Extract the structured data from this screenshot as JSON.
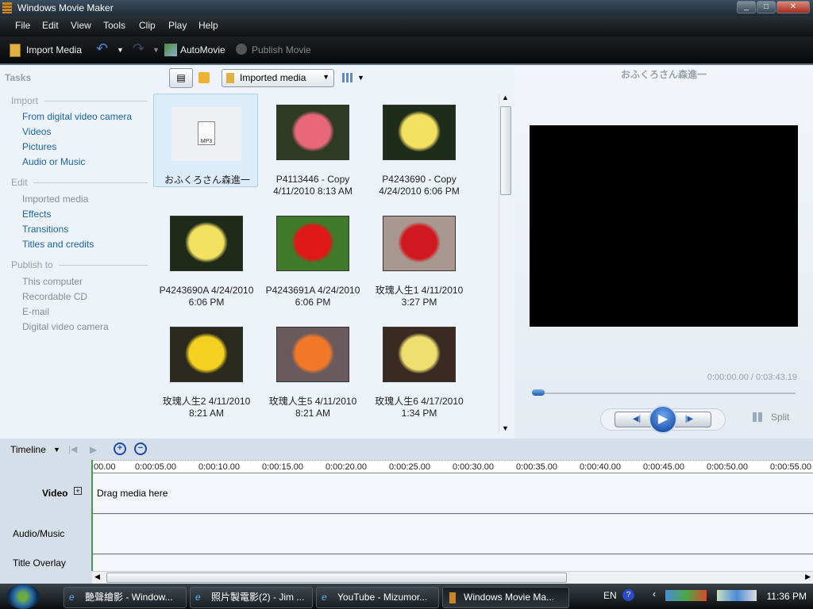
{
  "window": {
    "title": "Windows Movie Maker"
  },
  "menu": [
    "File",
    "Edit",
    "View",
    "Tools",
    "Clip",
    "Play",
    "Help"
  ],
  "toolbar": {
    "import": "Import Media",
    "automovie": "AutoMovie",
    "publish": "Publish Movie"
  },
  "tasks": {
    "title": "Tasks",
    "import_header": "Import",
    "import_items": [
      "From digital video camera",
      "Videos",
      "Pictures",
      "Audio or Music"
    ],
    "edit_header": "Edit",
    "edit_items": [
      "Imported media",
      "Effects",
      "Transitions",
      "Titles and credits"
    ],
    "publish_header": "Publish to",
    "publish_items": [
      "This computer",
      "Recordable CD",
      "E-mail",
      "Digital video camera"
    ]
  },
  "collection": {
    "selected": "Imported media"
  },
  "media_items": [
    {
      "name": "おふくろさん森進一",
      "date": "",
      "type": "mp3",
      "badge": "MP3"
    },
    {
      "name": "P4113446 - Copy",
      "date": "4/11/2010 8:13 AM",
      "color": "#e8687a",
      "bg": "#2f3a22"
    },
    {
      "name": "P4243690 - Copy",
      "date": "4/24/2010 6:06 PM",
      "color": "#f2e060",
      "bg": "#1f2c1a"
    },
    {
      "name": "P4243690A 4/24/2010",
      "date": "6:06 PM",
      "color": "#f2e060",
      "bg": "#1f2a18"
    },
    {
      "name": "P4243691A 4/24/2010",
      "date": "6:06 PM",
      "color": "#e01818",
      "bg": "#3f7a2a"
    },
    {
      "name": "玫瑰人生1 4/11/2010",
      "date": "3:27 PM",
      "color": "#d01820",
      "bg": "#a89890"
    },
    {
      "name": "玫瑰人生2 4/11/2010",
      "date": "8:21 AM",
      "color": "#f4d020",
      "bg": "#2a2a1e"
    },
    {
      "name": "玫瑰人生5 4/11/2010",
      "date": "8:21 AM",
      "color": "#f07828",
      "bg": "#6a5a5e"
    },
    {
      "name": "玫瑰人生6 4/17/2010",
      "date": "1:34 PM",
      "color": "#eee070",
      "bg": "#3a2a22"
    }
  ],
  "preview": {
    "title": "おふくろさん森進一",
    "time": "0:00:00.00 / 0:03:43.19",
    "progress": 0,
    "split": "Split"
  },
  "timeline": {
    "mode": "Timeline",
    "ticks": [
      "00.00",
      "0:00:05.00",
      "0:00:10.00",
      "0:00:15.00",
      "0:00:20.00",
      "0:00:25.00",
      "0:00:30.00",
      "0:00:35.00",
      "0:00:40.00",
      "0:00:45.00",
      "0:00:50.00",
      "0:00:55.00"
    ],
    "tracks": {
      "video": "Video",
      "audio": "Audio/Music",
      "title": "Title Overlay"
    },
    "drag_hint": "Drag media here"
  },
  "taskbar": {
    "buttons": [
      "艷聲繪影 - Window...",
      "照片製電影(2) - Jim ...",
      "YouTube - Mizumor...",
      "Windows Movie Ma..."
    ],
    "lang": "EN",
    "clock": "11:36 PM"
  }
}
